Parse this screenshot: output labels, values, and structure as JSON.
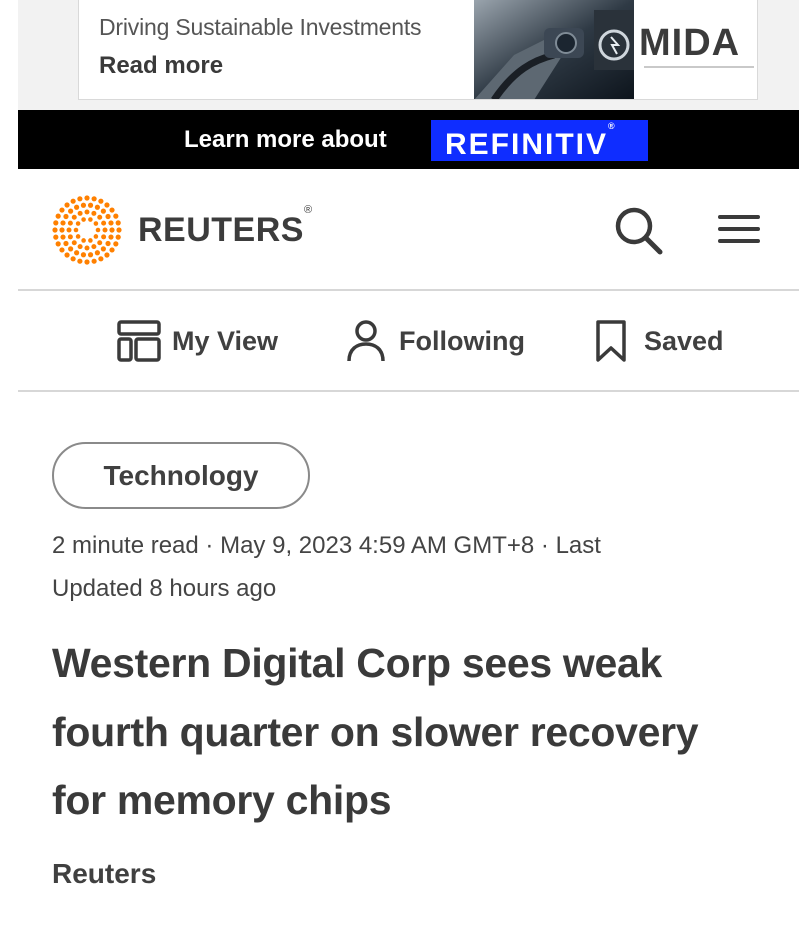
{
  "ad": {
    "headline": "Driving Sustainable Investments",
    "cta": "Read more",
    "brand": "MIDA"
  },
  "promo": {
    "text": "Learn more about",
    "badge": "REFINITIV",
    "badge_mark": "®",
    "badge_color": "#0f2dff"
  },
  "header": {
    "logo_text": "REUTERS",
    "logo_mark": "®",
    "logo_color": "#ff8000",
    "search_icon": "search-icon",
    "menu_icon": "hamburger-menu-icon"
  },
  "subnav": {
    "items": [
      {
        "label": "My View",
        "icon": "layout-grid-icon"
      },
      {
        "label": "Following",
        "icon": "person-icon"
      },
      {
        "label": "Saved",
        "icon": "bookmark-icon"
      }
    ]
  },
  "article": {
    "tag": "Technology",
    "meta_lines": [
      "2 minute read · May 9, 2023 4:59 AM GMT+8 · Last",
      "Updated 8 hours ago"
    ],
    "headline_lines": [
      "Western Digital Corp sees weak",
      "fourth quarter on slower recovery",
      "for memory chips"
    ],
    "byline": "Reuters"
  }
}
